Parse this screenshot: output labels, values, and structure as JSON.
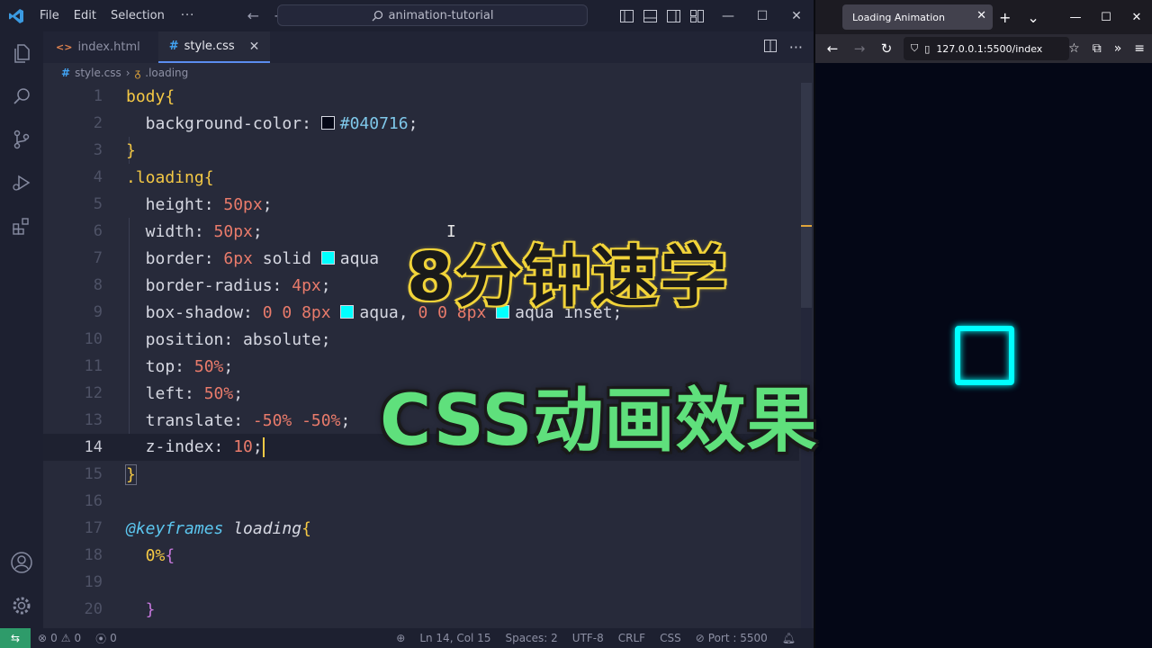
{
  "vscode": {
    "menu": [
      "File",
      "Edit",
      "Selection"
    ],
    "menu_more": "···",
    "search_text": "animation-tutorial",
    "tabs": [
      {
        "label": "index.html",
        "active": false
      },
      {
        "label": "style.css",
        "active": true
      }
    ],
    "breadcrumb": {
      "file": "style.css",
      "symbol": ".loading"
    },
    "code": [
      {
        "n": "1"
      },
      {
        "n": "2"
      },
      {
        "n": "3"
      },
      {
        "n": "4"
      },
      {
        "n": "5"
      },
      {
        "n": "6"
      },
      {
        "n": "7"
      },
      {
        "n": "8"
      },
      {
        "n": "9"
      },
      {
        "n": "10"
      },
      {
        "n": "11"
      },
      {
        "n": "12"
      },
      {
        "n": "13"
      },
      {
        "n": "14"
      },
      {
        "n": "15"
      },
      {
        "n": "16"
      },
      {
        "n": "17"
      },
      {
        "n": "18"
      },
      {
        "n": "19"
      },
      {
        "n": "20"
      }
    ],
    "code_text": {
      "l1_sel": "body",
      "l1_brace": "{",
      "l2_prop": "  background-color: ",
      "l2_val": "#040716",
      "l2_end": ";",
      "l3": "}",
      "l4_sel": ".loading",
      "l4_brace": "{",
      "l5_prop": "  height: ",
      "l5_val": "50px",
      "l5_end": ";",
      "l6_prop": "  width: ",
      "l6_val": "50px",
      "l6_end": ";",
      "l7_prop": "  border: ",
      "l7_val": "6px",
      "l7_mid": " solid ",
      "l7_color": "aqua",
      "l8_prop": "  border-radius: ",
      "l8_val": "4px",
      "l8_end": ";",
      "l9_prop": "  box-shadow: ",
      "l9_v1": "0 0 8px",
      "l9_c1": "aqua, ",
      "l9_v2": "0 0 8px",
      "l9_c2": "aqua inset;",
      "l10_prop": "  position: ",
      "l10_val": "absolute;",
      "l11_prop": "  top: ",
      "l11_val": "50%",
      "l11_end": ";",
      "l12_prop": "  left: ",
      "l12_val": "50%",
      "l12_end": ";",
      "l13_prop": "  translate: ",
      "l13_val": "-50% -50%",
      "l13_end": ";",
      "l14_prop": "  z-index: ",
      "l14_val": "10",
      "l14_end": ";",
      "l15": "}",
      "l17_at": "@keyframes",
      "l17_name": " loading",
      "l17_brace": "{",
      "l18_pct": "  0%",
      "l18_brace": "{",
      "l20_brace": "  }"
    },
    "status": {
      "errors": "0",
      "warnings": "0",
      "ports": "0",
      "position": "Ln 14, Col 15",
      "spaces": "Spaces: 2",
      "encoding": "UTF-8",
      "eol": "CRLF",
      "language": "CSS",
      "port": "Port : 5500"
    }
  },
  "browser": {
    "tab_title": "Loading Animation",
    "url": "127.0.0.1:5500/index",
    "page_background": "#040716",
    "loader_color": "#00ffff"
  },
  "overlay": {
    "caption_top": "8分钟速学",
    "caption_bottom": "CSS动画效果"
  }
}
